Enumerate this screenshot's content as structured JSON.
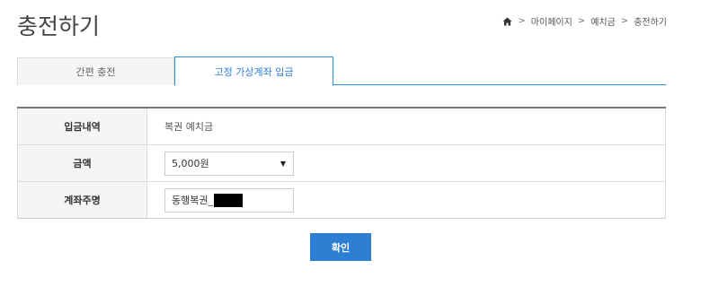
{
  "header": {
    "title": "충전하기",
    "breadcrumb": [
      {
        "label": "마이페이지"
      },
      {
        "label": "예치금"
      },
      {
        "label": "충전하기"
      }
    ],
    "separator": ">"
  },
  "tabs": [
    {
      "label": "간편 충전",
      "active": false
    },
    {
      "label": "고정 가상계좌 입금",
      "active": true
    }
  ],
  "form": {
    "deposit_label": "입금내역",
    "deposit_value": "복권 예치금",
    "amount_label": "금액",
    "amount_value": "5,000원",
    "account_label": "계좌주명",
    "account_value": "동행복권_"
  },
  "actions": {
    "confirm_label": "확인"
  },
  "colors": {
    "accent": "#2c7fd3",
    "tab_border": "#2f8be0"
  }
}
